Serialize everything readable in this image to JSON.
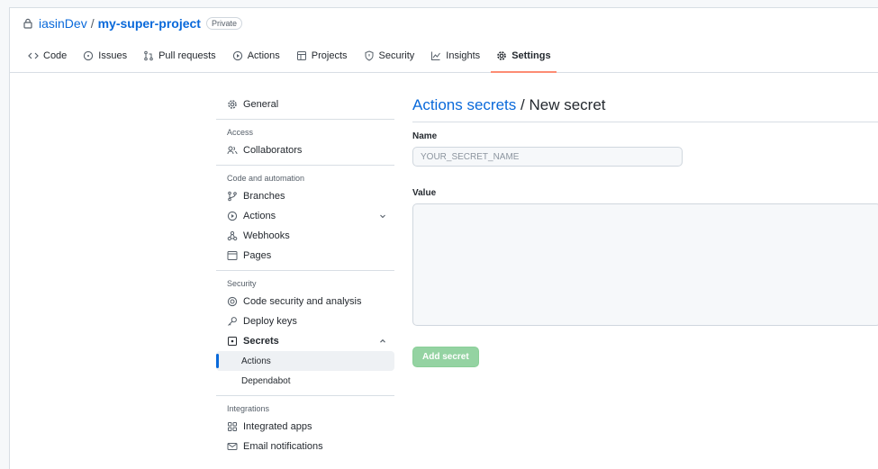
{
  "repo": {
    "owner": "iasinDev",
    "separator": "/",
    "name": "my-super-project",
    "visibility": "Private"
  },
  "tabs": [
    {
      "label": "Code",
      "icon": "code-icon"
    },
    {
      "label": "Issues",
      "icon": "issue-icon"
    },
    {
      "label": "Pull requests",
      "icon": "pull-request-icon"
    },
    {
      "label": "Actions",
      "icon": "play-icon"
    },
    {
      "label": "Projects",
      "icon": "table-icon"
    },
    {
      "label": "Security",
      "icon": "shield-icon"
    },
    {
      "label": "Insights",
      "icon": "graph-icon"
    },
    {
      "label": "Settings",
      "icon": "gear-icon",
      "selected": true
    }
  ],
  "sidebar": {
    "general": "General",
    "access_heading": "Access",
    "collaborators": "Collaborators",
    "code_heading": "Code and automation",
    "branches": "Branches",
    "actions": "Actions",
    "webhooks": "Webhooks",
    "pages": "Pages",
    "security_heading": "Security",
    "code_security": "Code security and analysis",
    "deploy_keys": "Deploy keys",
    "secrets": "Secrets",
    "secrets_actions": "Actions",
    "secrets_dependabot": "Dependabot",
    "integrations_heading": "Integrations",
    "integrated_apps": "Integrated apps",
    "email_notifications": "Email notifications"
  },
  "main": {
    "breadcrumb_link": "Actions secrets",
    "breadcrumb_sep": "/",
    "title": "New secret",
    "name_label": "Name",
    "name_placeholder": "YOUR_SECRET_NAME",
    "value_label": "Value",
    "submit_label": "Add secret"
  },
  "colors": {
    "link": "#0969da",
    "tab_underline": "#fd8c73",
    "button_disabled": "#94d3a2"
  }
}
